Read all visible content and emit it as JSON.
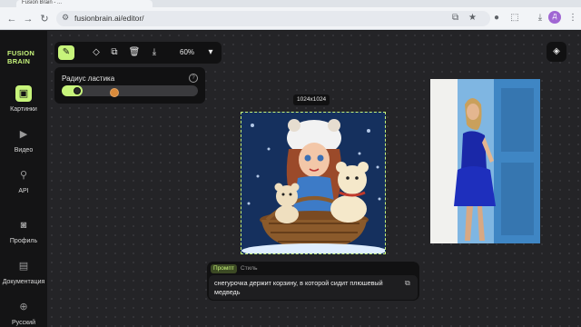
{
  "browser": {
    "active_tab_title": "Fusion Brain - ...",
    "second_tab_title": "...",
    "url": "fusionbrain.ai/editor/",
    "profile_initial": "Д"
  },
  "sidebar": {
    "logo_line1": "FUSION",
    "logo_line2": "BRAIN",
    "items": [
      {
        "label": "Картинки",
        "icon": "image-icon"
      },
      {
        "label": "Видео",
        "icon": "play-icon"
      },
      {
        "label": "API",
        "icon": "api-icon"
      },
      {
        "label": "Профиль",
        "icon": "profile-icon"
      },
      {
        "label": "Документация",
        "icon": "document-icon"
      },
      {
        "label": "Русский",
        "icon": "globe-icon"
      }
    ]
  },
  "editor_toolbar": {
    "zoom": "60%",
    "tools": [
      "eraser-icon",
      "fill-icon",
      "copy-icon",
      "trash-icon",
      "download-icon",
      "chevron-down-icon"
    ]
  },
  "eraser_panel": {
    "title": "Радиус ластика",
    "radius_fraction": 0.15
  },
  "canvas": {
    "selected_image_size": "1024x1024"
  },
  "prompt_card": {
    "tab_prompt": "Промпт",
    "tab_style": "Стиль",
    "prompt_text": "снегурочка держит корзину, в которой сидит плюшевый медведь"
  },
  "colors": {
    "accent": "#c7f47b",
    "canvas_bg": "#242427",
    "panel_bg": "#111112"
  }
}
